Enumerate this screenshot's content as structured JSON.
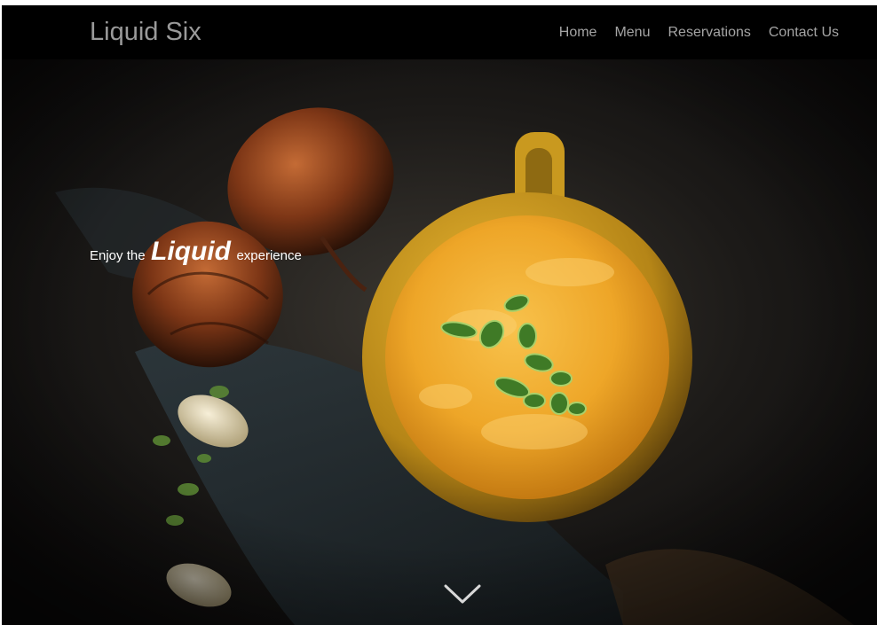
{
  "header": {
    "brand": "Liquid Six",
    "nav": [
      {
        "label": "Home"
      },
      {
        "label": "Menu"
      },
      {
        "label": "Reservations"
      },
      {
        "label": "Contact Us"
      }
    ]
  },
  "hero": {
    "tagline_prefix": "Enjoy the",
    "tagline_emphasis": "Liquid",
    "tagline_suffix": "experience",
    "scroll_icon": "chevron-down-icon"
  },
  "colors": {
    "navbar_bg": "#000000",
    "nav_text": "#a4a4a4",
    "brand_text": "#9a9a9a",
    "soup": "#f0b23a",
    "bowl": "#d4a020"
  }
}
